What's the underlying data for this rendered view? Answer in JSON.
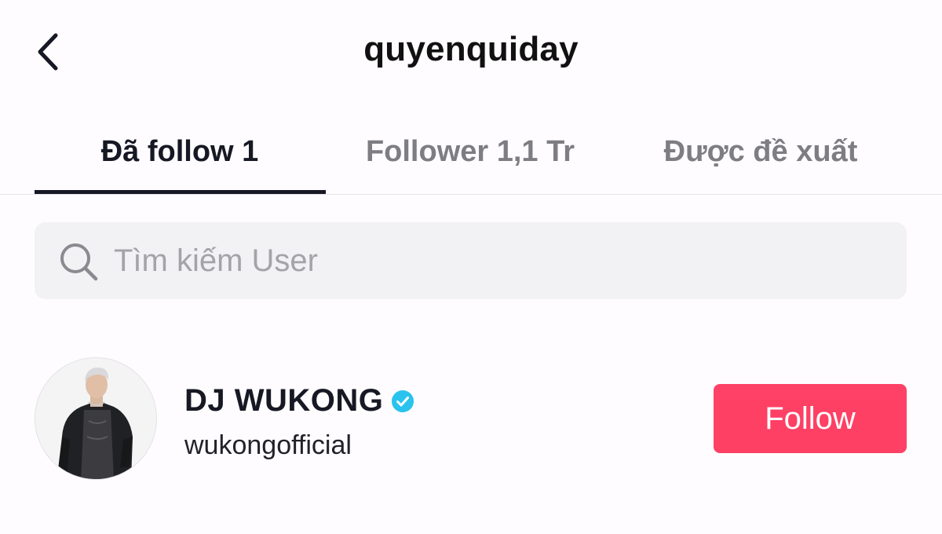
{
  "header": {
    "title": "quyenquiday",
    "back_icon": "chevron-left-icon"
  },
  "tabs": [
    {
      "label": "Đã follow 1",
      "active": true
    },
    {
      "label": "Follower 1,1 Tr",
      "active": false
    },
    {
      "label": "Được đề xuất",
      "active": false
    }
  ],
  "search": {
    "placeholder": "Tìm kiếm User",
    "value": "",
    "icon": "search-icon"
  },
  "users": [
    {
      "name": "DJ WUKONG",
      "verified": true,
      "handle": "wukongofficial",
      "button_label": "Follow"
    }
  ],
  "colors": {
    "accent": "#fe2c55",
    "verified": "#20d5ec",
    "text_primary": "#161823",
    "text_secondary": "#7d7d82",
    "search_bg": "#f2f1f4"
  }
}
